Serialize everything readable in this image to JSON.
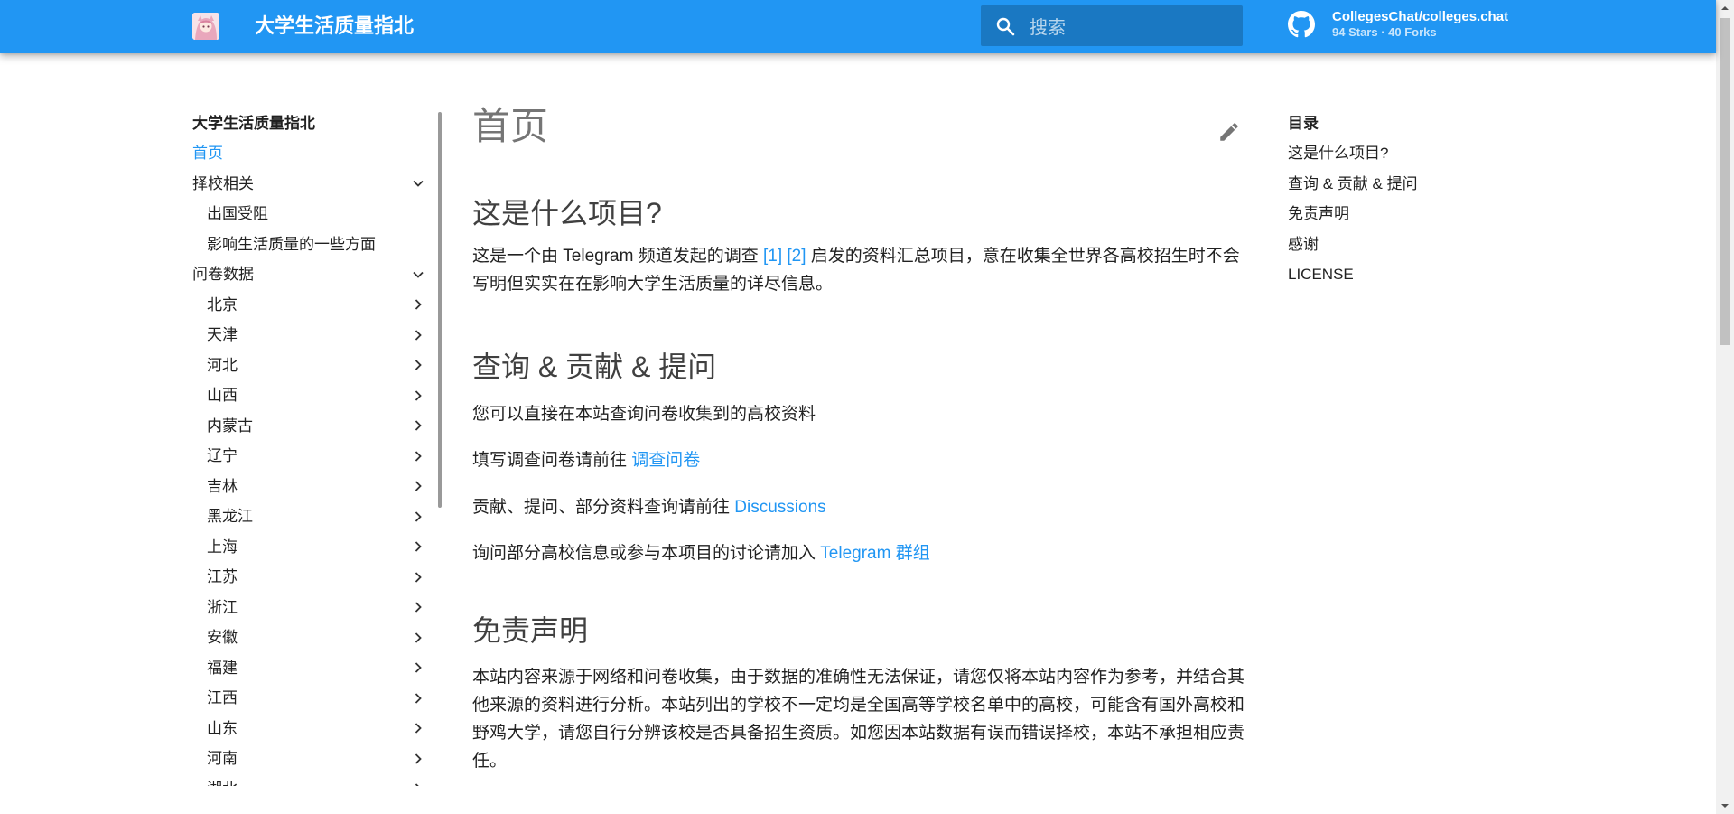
{
  "header": {
    "site_title": "大学生活质量指北",
    "search_placeholder": "搜索",
    "repo_name": "CollegesChat/colleges.chat",
    "repo_stats": "94 Stars · 40 Forks",
    "logo_icon": "avatar-logo-icon",
    "search_icon": "search-icon",
    "repo_icon": "github-icon",
    "color": "#2196f3"
  },
  "nav": {
    "title": "大学生活质量指北",
    "items": [
      {
        "label": "首页"
      },
      {
        "label": "择校相关"
      },
      {
        "label": "出国受阻"
      },
      {
        "label": "影响生活质量的一些方面"
      },
      {
        "label": "问卷数据"
      },
      {
        "label": "北京"
      },
      {
        "label": "天津"
      },
      {
        "label": "河北"
      },
      {
        "label": "山西"
      },
      {
        "label": "内蒙古"
      },
      {
        "label": "辽宁"
      },
      {
        "label": "吉林"
      },
      {
        "label": "黑龙江"
      },
      {
        "label": "上海"
      },
      {
        "label": "江苏"
      },
      {
        "label": "浙江"
      },
      {
        "label": "安徽"
      },
      {
        "label": "福建"
      },
      {
        "label": "江西"
      },
      {
        "label": "山东"
      },
      {
        "label": "河南"
      },
      {
        "label": "湖北"
      }
    ]
  },
  "main": {
    "title": "首页",
    "edit_icon": "pencil-icon",
    "s1_heading": "这是什么项目?",
    "s1_p1_a": "这是一个由 Telegram 频道发起的调查 ",
    "s1_p1_link1": "[1]",
    "s1_p1_link2": "[2]",
    "s1_p1_b": " 启发的资料汇总项目，意在收集全世界各高校招生时不会写明但实实在在影响大学生活质量的详尽信息。",
    "s2_heading": "查询 & 贡献 & 提问",
    "s2_p1": "您可以直接在本站查询问卷收集到的高校资料",
    "s2_p2_a": "填写调查问卷请前往 ",
    "s2_p2_link": "调查问卷",
    "s2_p3_a": "贡献、提问、部分资料查询请前往 ",
    "s2_p3_link": "Discussions",
    "s2_p4_a": "询问部分高校信息或参与本项目的讨论请加入 ",
    "s2_p4_link": "Telegram 群组",
    "s3_heading": "免责声明",
    "s3_p1": "本站内容来源于网络和问卷收集，由于数据的准确性无法保证，请您仅将本站内容作为参考，并结合其他来源的资料进行分析。本站列出的学校不一定均是全国高等学校名单中的高校，可能含有国外高校和野鸡大学，请您自行分辨该校是否具备招生资质。如您因本站数据有误而错误择校，本站不承担相应责任。"
  },
  "toc": {
    "title": "目录",
    "items": [
      {
        "label": "这是什么项目?"
      },
      {
        "label": "查询 & 贡献 & 提问"
      },
      {
        "label": "免责声明"
      },
      {
        "label": "感谢"
      },
      {
        "label": "LICENSE"
      }
    ]
  }
}
